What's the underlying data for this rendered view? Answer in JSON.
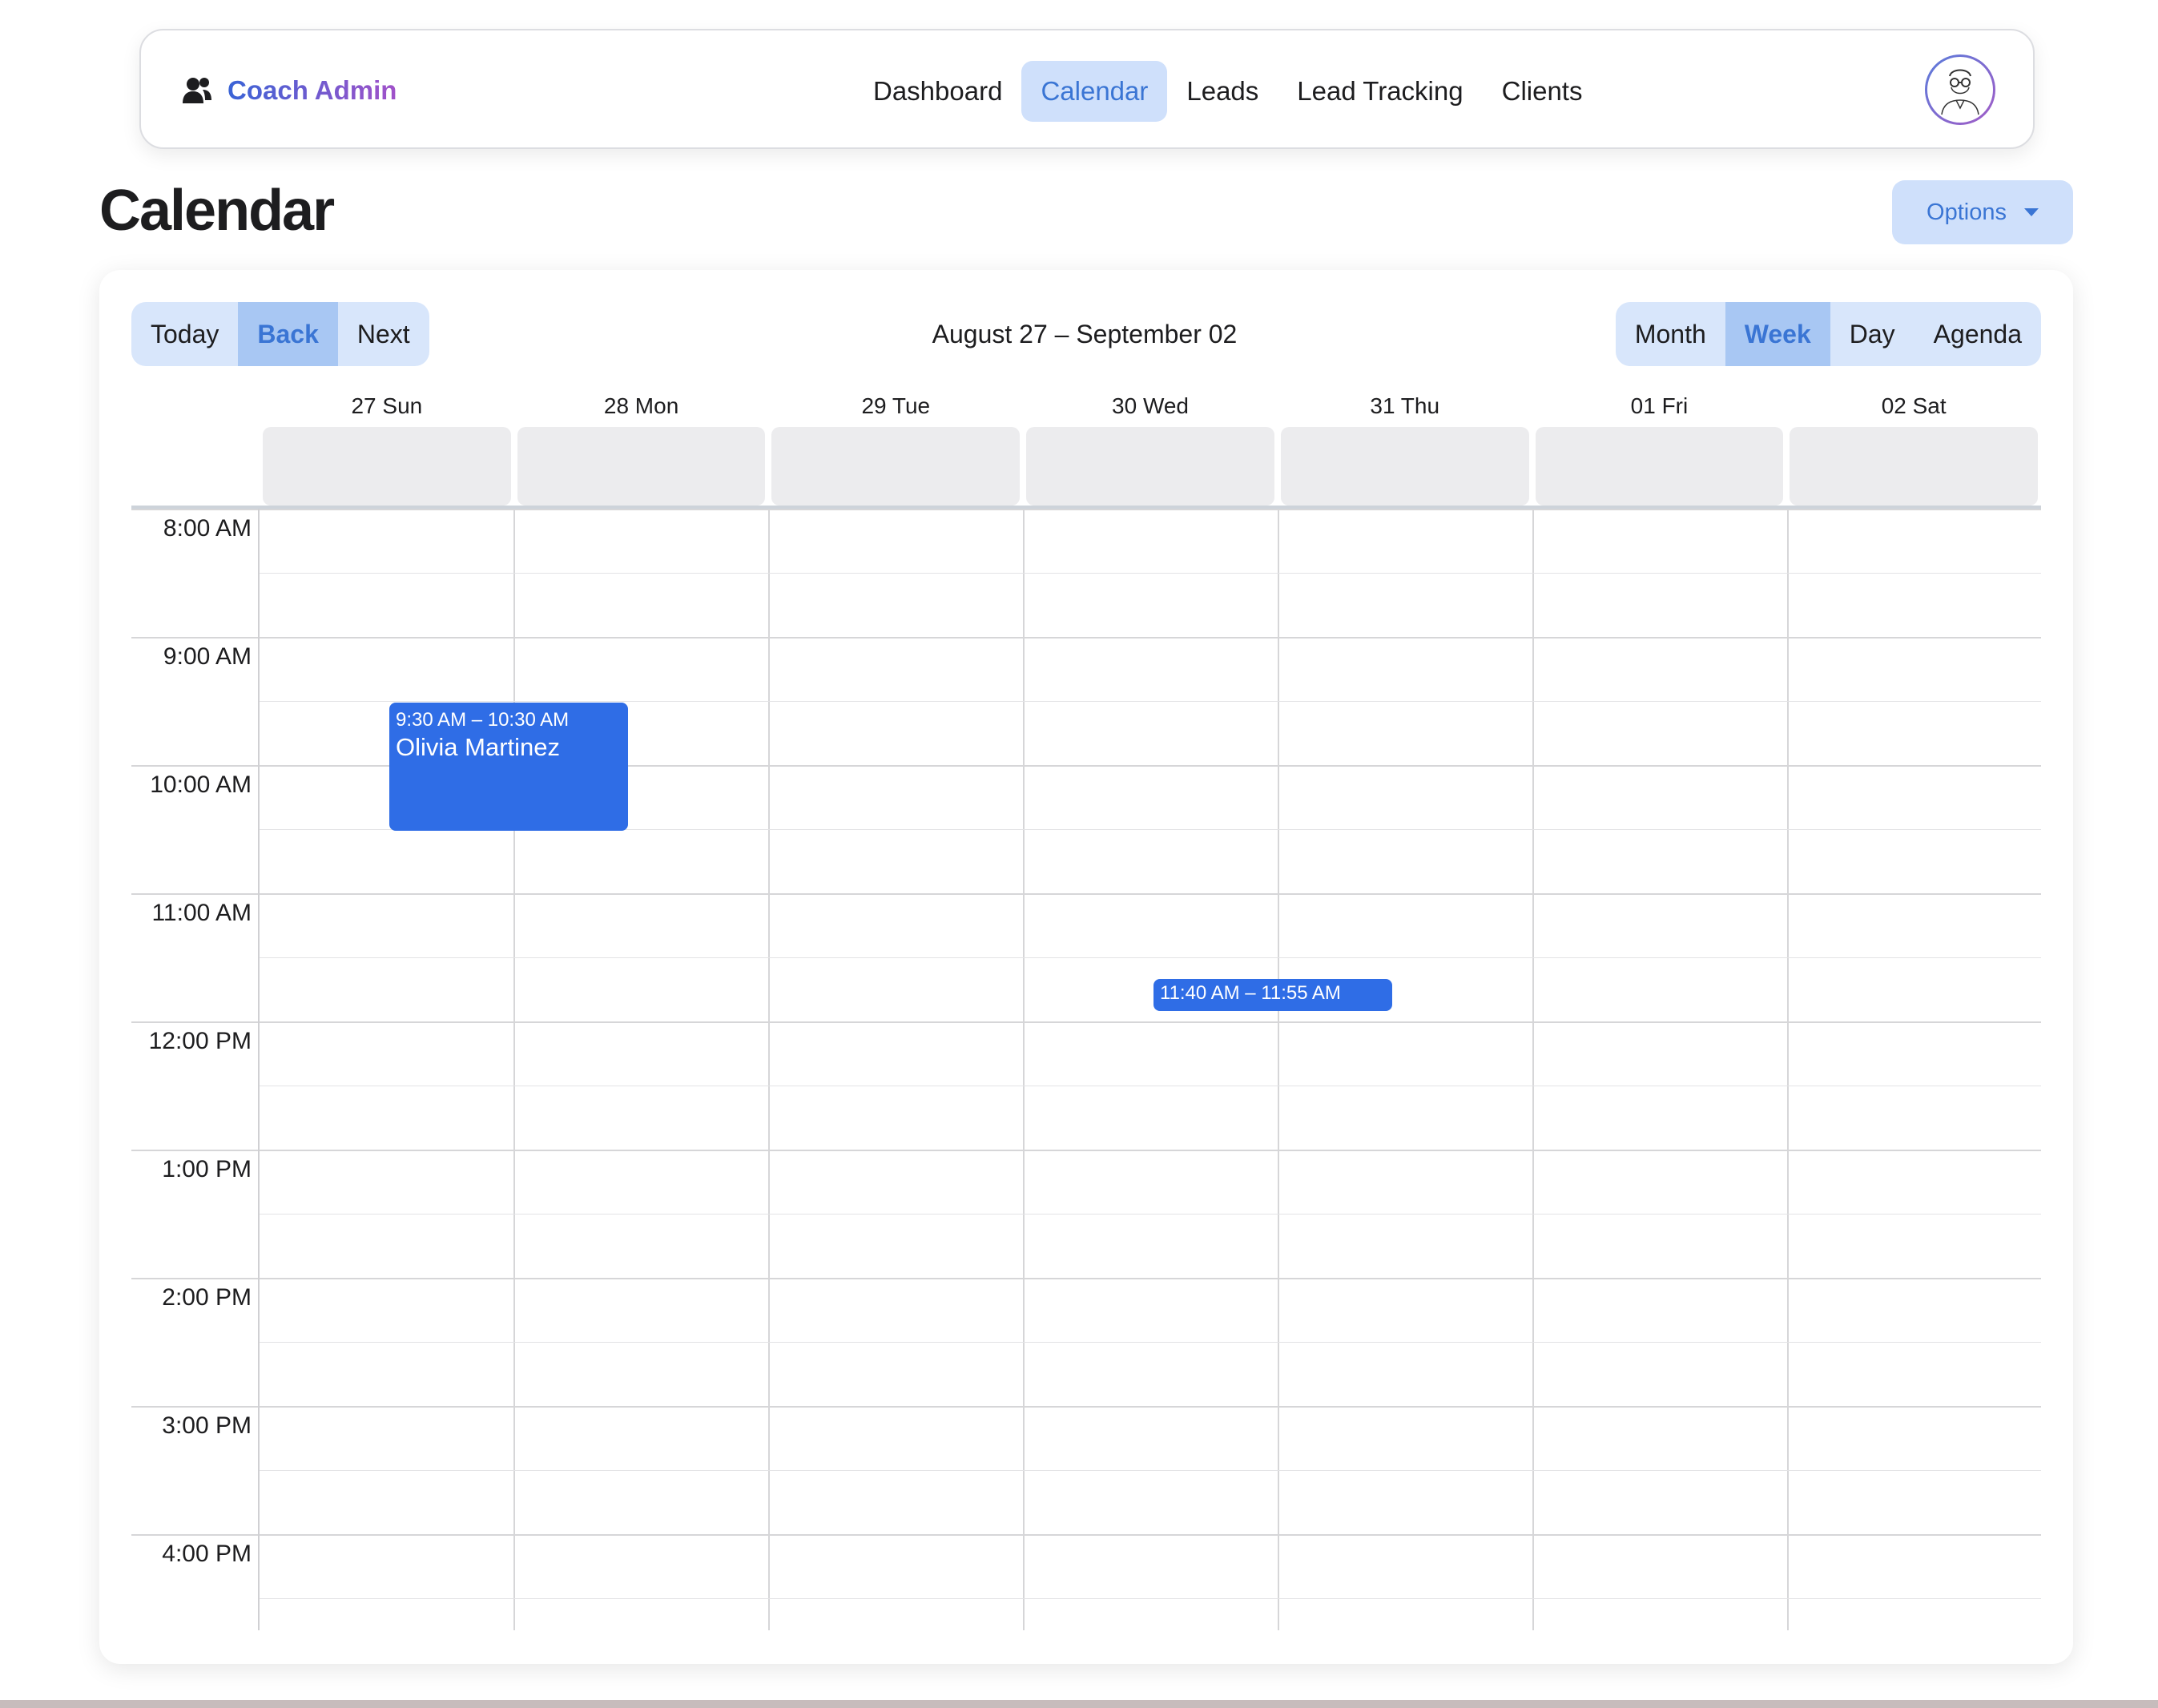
{
  "navbar": {
    "brand": "Coach Admin",
    "brand_icon": "users-icon",
    "links": [
      {
        "label": "Dashboard",
        "active": false
      },
      {
        "label": "Calendar",
        "active": true
      },
      {
        "label": "Leads",
        "active": false
      },
      {
        "label": "Lead Tracking",
        "active": false
      },
      {
        "label": "Clients",
        "active": false
      }
    ],
    "avatar_icon": "user-avatar-icon"
  },
  "page": {
    "title": "Calendar",
    "options_label": "Options"
  },
  "toolbar": {
    "today": "Today",
    "back": "Back",
    "next": "Next",
    "range": "August 27 – September 02",
    "views": {
      "month": "Month",
      "week": "Week",
      "day": "Day",
      "agenda": "Agenda"
    },
    "active_view": "Week"
  },
  "calendar": {
    "days": [
      "27 Sun",
      "28 Mon",
      "29 Tue",
      "30 Wed",
      "31 Thu",
      "01 Fri",
      "02 Sat"
    ],
    "hours": [
      "8:00 AM",
      "9:00 AM",
      "10:00 AM",
      "11:00 AM",
      "12:00 PM",
      "1:00 PM",
      "2:00 PM",
      "3:00 PM",
      "4:00 PM"
    ],
    "events": [
      {
        "time": "9:30 AM – 10:30 AM",
        "title": "Olivia Martinez",
        "day": "28 Mon"
      },
      {
        "time": "11:40 AM – 11:55 AM",
        "title": "",
        "day": "31 Thu"
      }
    ]
  },
  "colors": {
    "accent": "#3a75d4",
    "event": "#2f6de6",
    "active_bg": "#cfe0fb"
  }
}
